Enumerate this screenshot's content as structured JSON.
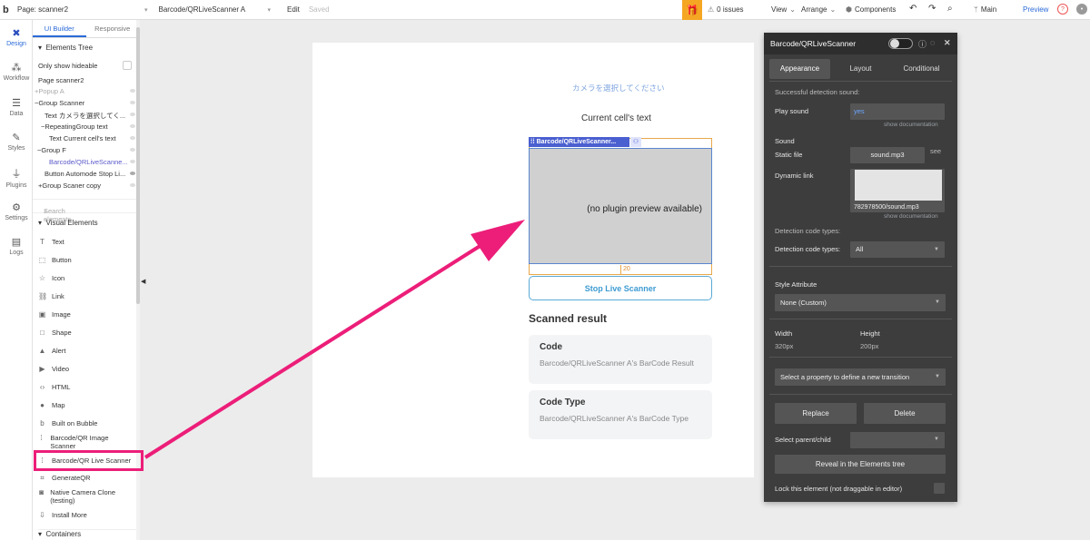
{
  "topbar": {
    "logo": "b",
    "page": "Page: scanner2",
    "element": "Barcode/QRLiveScanner A",
    "edit": "Edit",
    "saved": "Saved",
    "issues": "0 issues",
    "view": "View",
    "arrange": "Arrange",
    "components": "Components",
    "branch": "Main",
    "preview": "Preview"
  },
  "rail": [
    {
      "label": "Design",
      "icon": "design-icon"
    },
    {
      "label": "Workflow",
      "icon": "workflow-icon"
    },
    {
      "label": "Data",
      "icon": "data-icon"
    },
    {
      "label": "Styles",
      "icon": "styles-icon"
    },
    {
      "label": "Plugins",
      "icon": "plugins-icon"
    },
    {
      "label": "Settings",
      "icon": "settings-icon"
    },
    {
      "label": "Logs",
      "icon": "logs-icon"
    }
  ],
  "panel": {
    "tabs": [
      "UI Builder",
      "Responsive"
    ],
    "elements_tree": "Elements Tree",
    "only_show_hideable": "Only show hideable",
    "tree": [
      "Page scanner2",
      "+Popup A",
      "−Group Scanner",
      "Text カメラを選択してく...",
      "−RepeatingGroup text",
      "Text Current cell's text",
      "−Group F",
      "Barcode/QRLiveScanne...",
      "Button Automode Stop Li...",
      "+Group Scaner copy"
    ],
    "search_placeholder": "Search elements",
    "visual_elements": "Visual Elements",
    "visual_items": [
      {
        "label": "Text",
        "icon": "text-icon"
      },
      {
        "label": "Button",
        "icon": "button-icon"
      },
      {
        "label": "Icon",
        "icon": "star-icon"
      },
      {
        "label": "Link",
        "icon": "link-icon"
      },
      {
        "label": "Image",
        "icon": "image-icon"
      },
      {
        "label": "Shape",
        "icon": "shape-icon"
      },
      {
        "label": "Alert",
        "icon": "alert-icon"
      },
      {
        "label": "Video",
        "icon": "video-icon"
      },
      {
        "label": "HTML",
        "icon": "code-icon"
      },
      {
        "label": "Map",
        "icon": "map-pin-icon"
      },
      {
        "label": "Built on Bubble",
        "icon": "bubble-icon"
      },
      {
        "label": "Barcode/QR Image Scanner",
        "icon": "barcode-icon"
      },
      {
        "label": "Barcode/QR Live Scanner",
        "icon": "barcode-icon"
      },
      {
        "label": "GenerateQR",
        "icon": "qr-icon"
      },
      {
        "label": "Native Camera Clone (testing)",
        "icon": "camera-icon"
      },
      {
        "label": "Install More",
        "icon": "download-icon"
      }
    ],
    "containers": "Containers"
  },
  "canvas": {
    "camera_text": "カメラを選択してください",
    "current_cell": "Current cell's text",
    "scanner_tag": "Barcode/QRLiveScanner...",
    "no_preview": "(no plugin preview available)",
    "gap_value": "20",
    "stop_button": "Stop Live Scanner",
    "scanned_result": "Scanned result",
    "cards": [
      {
        "title": "Code",
        "value": "Barcode/QRLiveScanner A's BarCode Result"
      },
      {
        "title": "Code Type",
        "value": "Barcode/QRLiveScanner A's BarCode Type"
      }
    ]
  },
  "editor": {
    "title": "Barcode/QRLiveScanner",
    "tabs": [
      "Appearance",
      "Layout",
      "Conditional"
    ],
    "success_sound": "Successful detection sound:",
    "play_sound_label": "Play sound",
    "play_sound_value": "yes",
    "show_documentation": "show documentation",
    "sound_label": "Sound",
    "static_file_label": "Static file",
    "static_file_value": "sound.mp3",
    "see": "see",
    "dynamic_link_label": "Dynamic link",
    "dynamic_link_value": "782978500/sound.mp3",
    "detection_types_heading": "Detection code types:",
    "detection_types_label": "Detection code types:",
    "detection_types_value": "All",
    "style_attribute": "Style Attribute",
    "style_value": "None (Custom)",
    "width_label": "Width",
    "width_value": "320px",
    "height_label": "Height",
    "height_value": "200px",
    "transition": "Select a property to define a new transition",
    "replace": "Replace",
    "delete": "Delete",
    "select_parent": "Select parent/child",
    "reveal": "Reveal in the Elements tree",
    "lock": "Lock this element (not draggable in editor)"
  },
  "colors": {
    "accent": "#2b6ad8",
    "highlight": "#ec1e79",
    "editor_bg": "#3d3d3d",
    "scanner_tag": "#4a5fd0"
  }
}
